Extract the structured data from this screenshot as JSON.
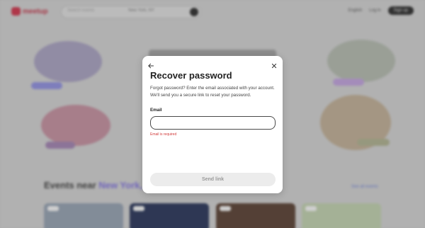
{
  "header": {
    "logo_text": "meetup",
    "search_keyword_placeholder": "Search events",
    "search_location": "New York, NY",
    "language": "English",
    "login_label": "Log in",
    "signup_label": "Sign up"
  },
  "events": {
    "heading_prefix": "Events near",
    "heading_city": "New York, NY",
    "see_all_label": "See all events"
  },
  "modal": {
    "title": "Recover password",
    "description": "Forgot password? Enter the email associated with your account. We'll send you a secure link to reset your password.",
    "email_label": "Email",
    "email_value": "",
    "email_error": "Email is required",
    "submit_label": "Send link"
  },
  "icons": {
    "back": "arrow-left-icon",
    "close": "close-icon"
  },
  "colors": {
    "brand": "#b8384b",
    "error": "#d23c3c",
    "accent_purple": "#7b6fd0"
  }
}
